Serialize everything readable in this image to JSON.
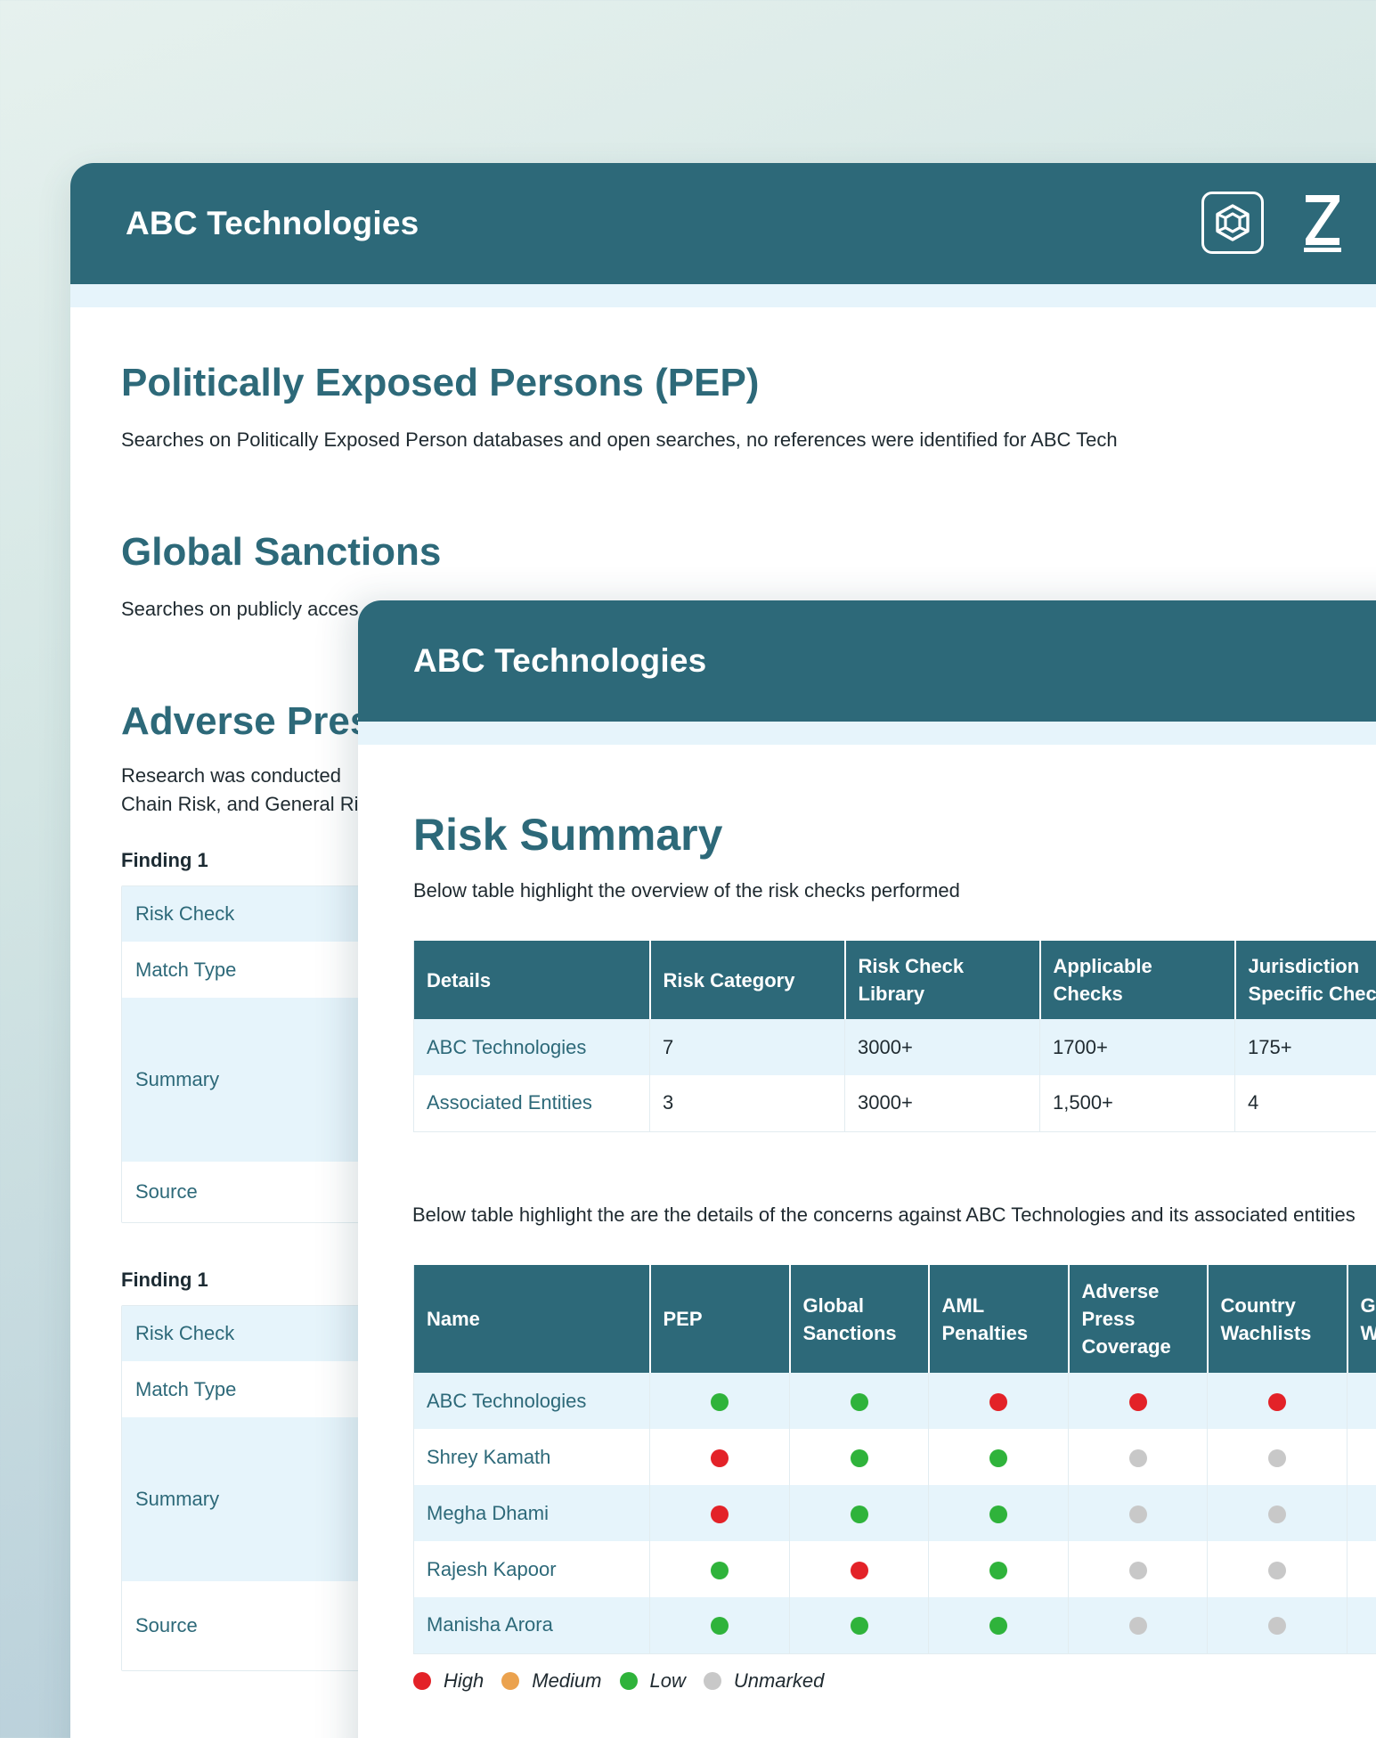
{
  "colors": {
    "primary": "#2d6979",
    "row_shade": "#e6f4fb",
    "high": "#e32228",
    "medium": "#eba24e",
    "low": "#2fb33b",
    "unmarked": "#c8c8c8"
  },
  "back_doc": {
    "title": "ABC Technologies",
    "logo_icon": "hexagon-logo-icon",
    "z_icon": "z-logo-icon",
    "pep": {
      "title": "Politically Exposed Persons (PEP)",
      "text": "Searches on Politically Exposed Person databases and open searches, no references were identified for ABC Tech"
    },
    "sanctions": {
      "title": "Global Sanctions",
      "text": "Searches on publicly acces"
    },
    "adverse": {
      "title": "Adverse Pres",
      "text_line1": "Research was conducted",
      "text_line2": "Chain Risk, and General Ri"
    },
    "findings": [
      {
        "label": "Finding 1",
        "rows": [
          "Risk Check",
          "Match Type",
          "Summary",
          "Source"
        ]
      },
      {
        "label": "Finding 1",
        "rows": [
          "Risk Check",
          "Match Type",
          "Summary",
          "Source"
        ]
      }
    ]
  },
  "front_doc": {
    "title": "ABC Technologies",
    "risk_summary_title": "Risk Summary",
    "risk_summary_text": "Below table highlight the overview of the risk checks performed",
    "summary_table": {
      "headers": [
        "Details",
        "Risk Category",
        "Risk Check Library",
        "Applicable Checks",
        "Jurisdiction Specific Checks"
      ],
      "rows": [
        [
          "ABC Technologies",
          "7",
          "3000+",
          "1700+",
          "175+"
        ],
        [
          "Associated Entities",
          "3",
          "3000+",
          "1,500+",
          "4"
        ]
      ]
    },
    "concerns_text": "Below table highlight the are the details of the concerns against ABC Technologies and its associated entities",
    "concerns_table": {
      "headers": [
        "Name",
        "PEP",
        "Global Sanctions",
        "AML Penalties",
        "Adverse Press Coverage",
        "Country Wachlists",
        "Global Watchlists"
      ],
      "rows": [
        {
          "name": "ABC Technologies",
          "status": [
            "low",
            "low",
            "high",
            "high",
            "high"
          ]
        },
        {
          "name": "Shrey Kamath",
          "status": [
            "high",
            "low",
            "low",
            "unmarked",
            "unmarked"
          ]
        },
        {
          "name": "Megha Dhami",
          "status": [
            "high",
            "low",
            "low",
            "unmarked",
            "unmarked"
          ]
        },
        {
          "name": "Rajesh Kapoor",
          "status": [
            "low",
            "high",
            "low",
            "unmarked",
            "unmarked"
          ]
        },
        {
          "name": "Manisha Arora",
          "status": [
            "low",
            "low",
            "low",
            "unmarked",
            "unmarked"
          ]
        }
      ]
    },
    "legend": [
      {
        "key": "high",
        "label": "High"
      },
      {
        "key": "medium",
        "label": "Medium"
      },
      {
        "key": "low",
        "label": "Low"
      },
      {
        "key": "unmarked",
        "label": "Unmarked"
      }
    ]
  }
}
